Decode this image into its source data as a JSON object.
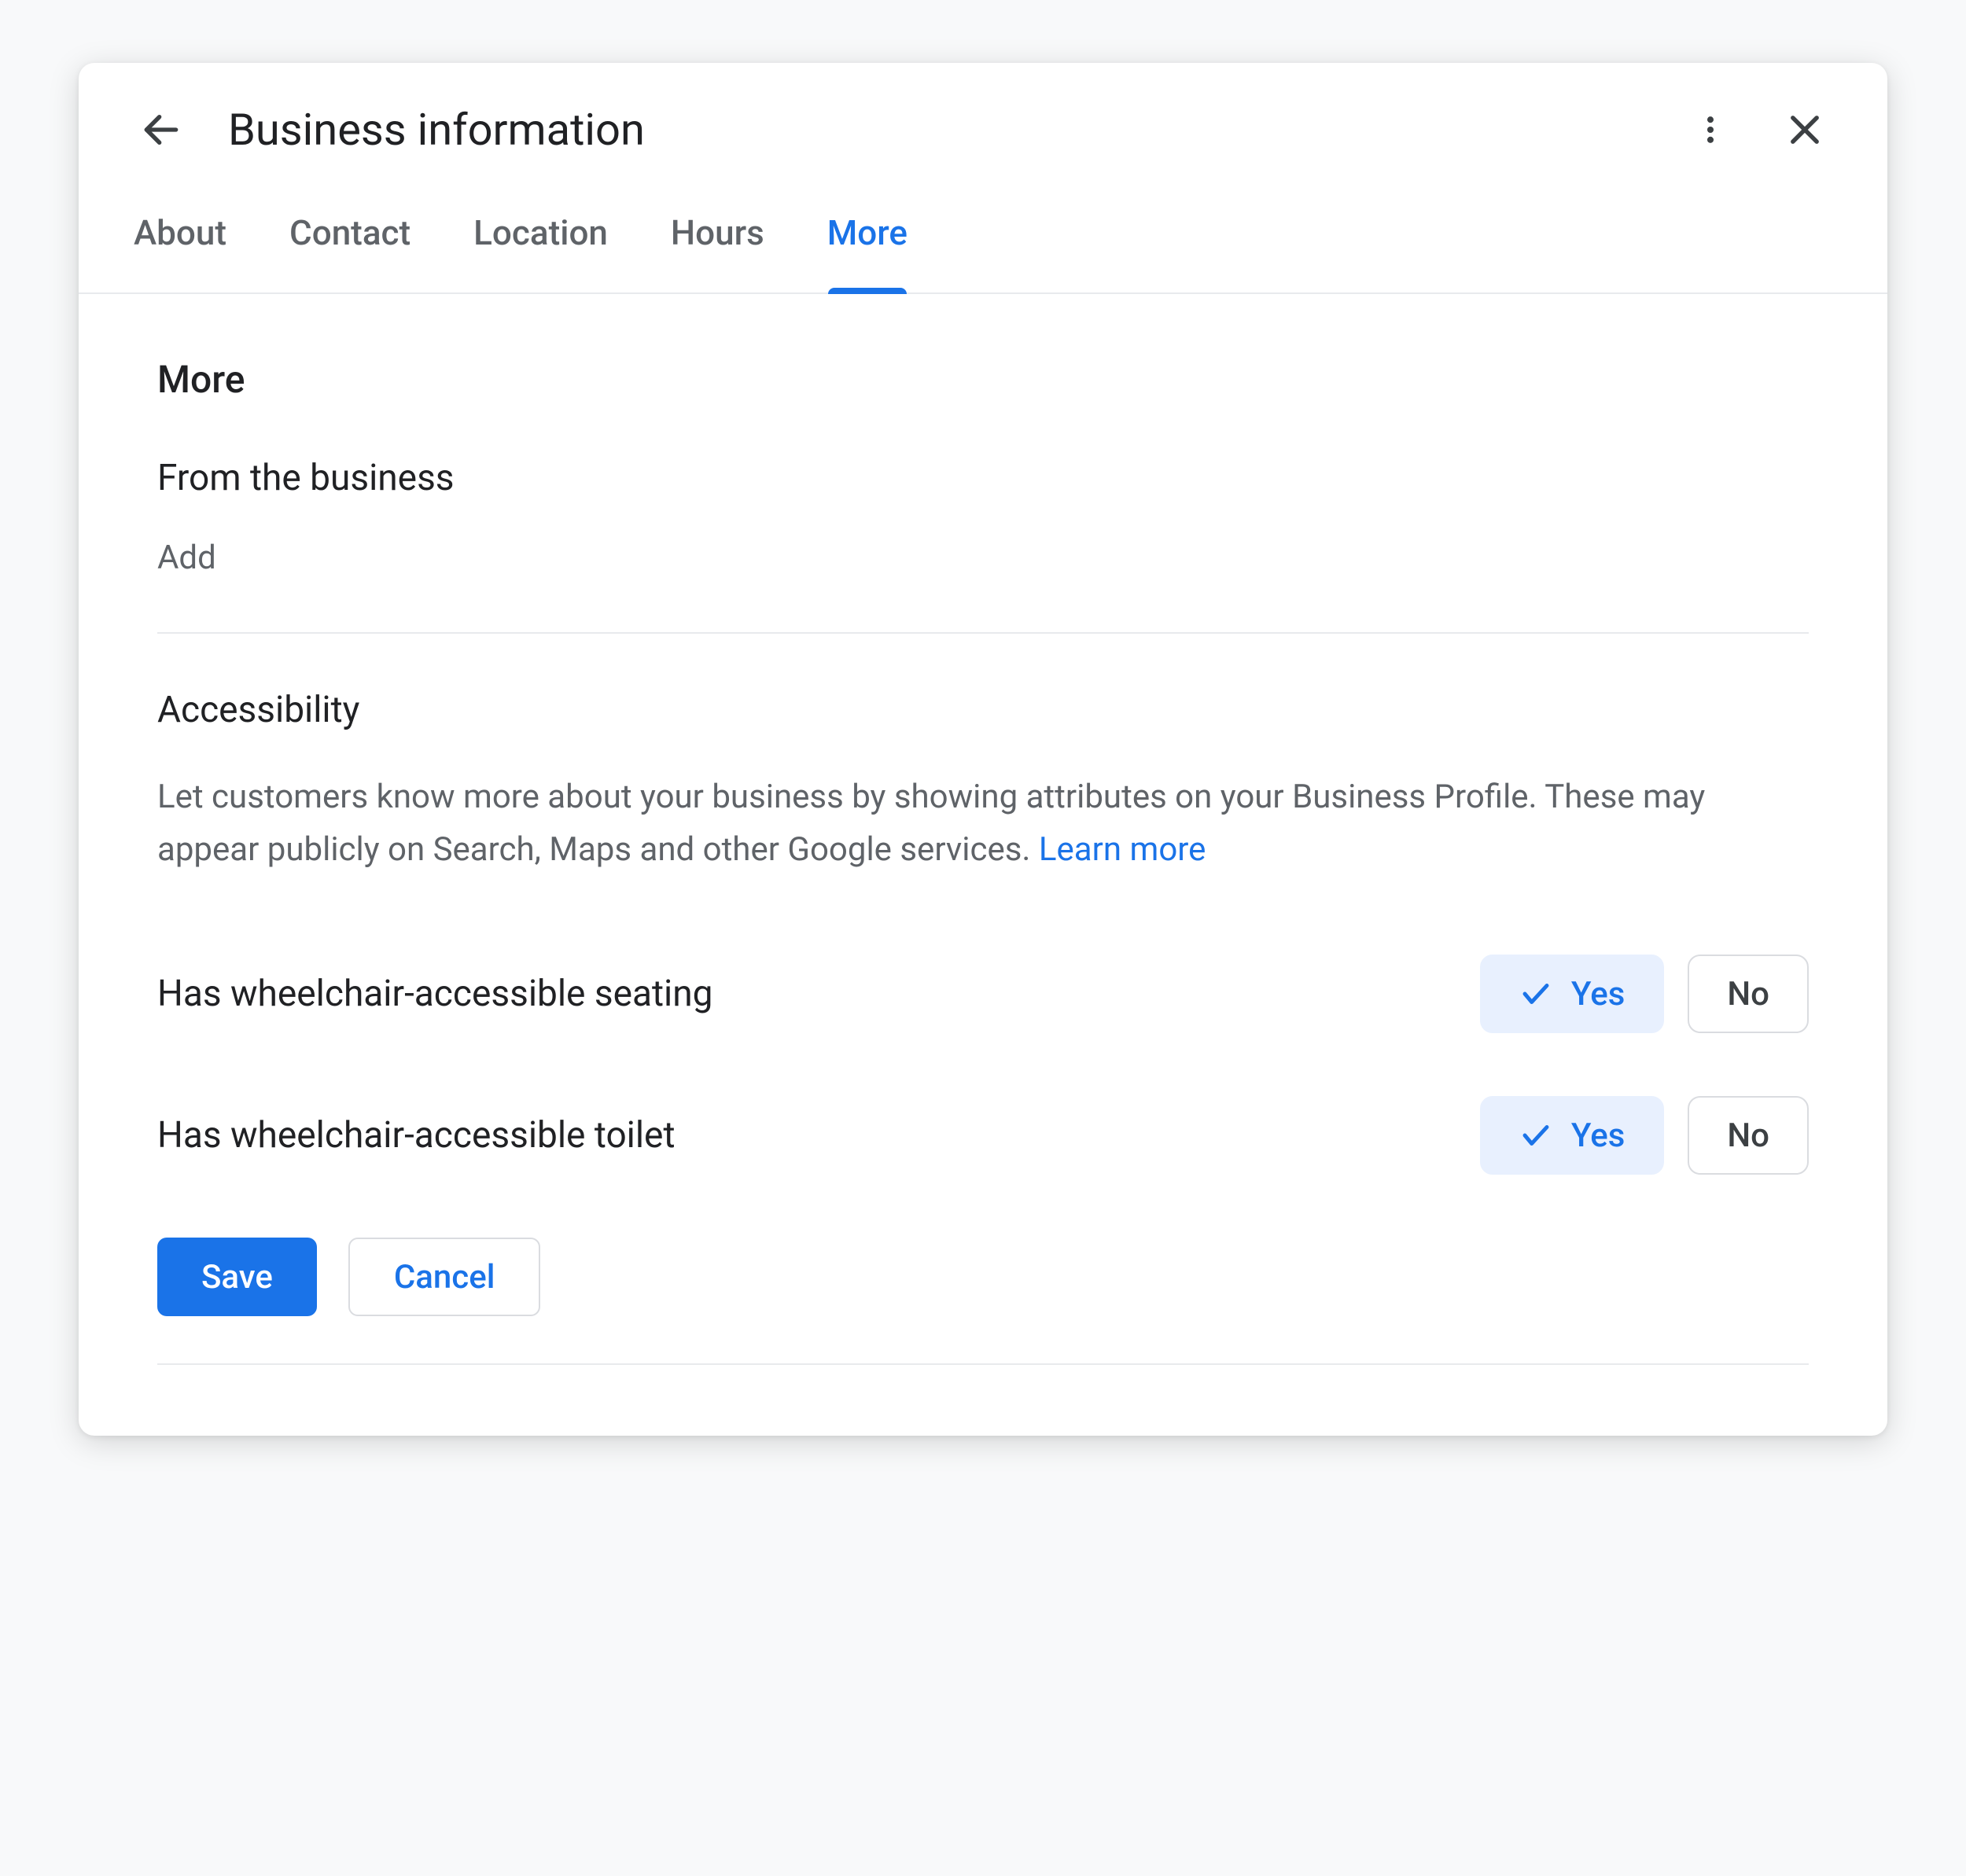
{
  "header": {
    "title": "Business information"
  },
  "tabs": [
    "About",
    "Contact",
    "Location",
    "Hours",
    "More"
  ],
  "activeTab": "More",
  "content": {
    "sectionTitle": "More",
    "fromBusiness": {
      "title": "From the business",
      "addLabel": "Add"
    },
    "accessibility": {
      "title": "Accessibility",
      "description": "Let customers know more about your business by showing attributes on your Business Profile. These may appear publicly on Search, Maps and other Google services. ",
      "learnMore": "Learn more",
      "attributes": [
        {
          "label": "Has wheelchair-accessible seating",
          "yes": "Yes",
          "no": "No",
          "selected": "yes"
        },
        {
          "label": "Has wheelchair-accessible toilet",
          "yes": "Yes",
          "no": "No",
          "selected": "yes"
        }
      ]
    }
  },
  "actions": {
    "save": "Save",
    "cancel": "Cancel"
  }
}
